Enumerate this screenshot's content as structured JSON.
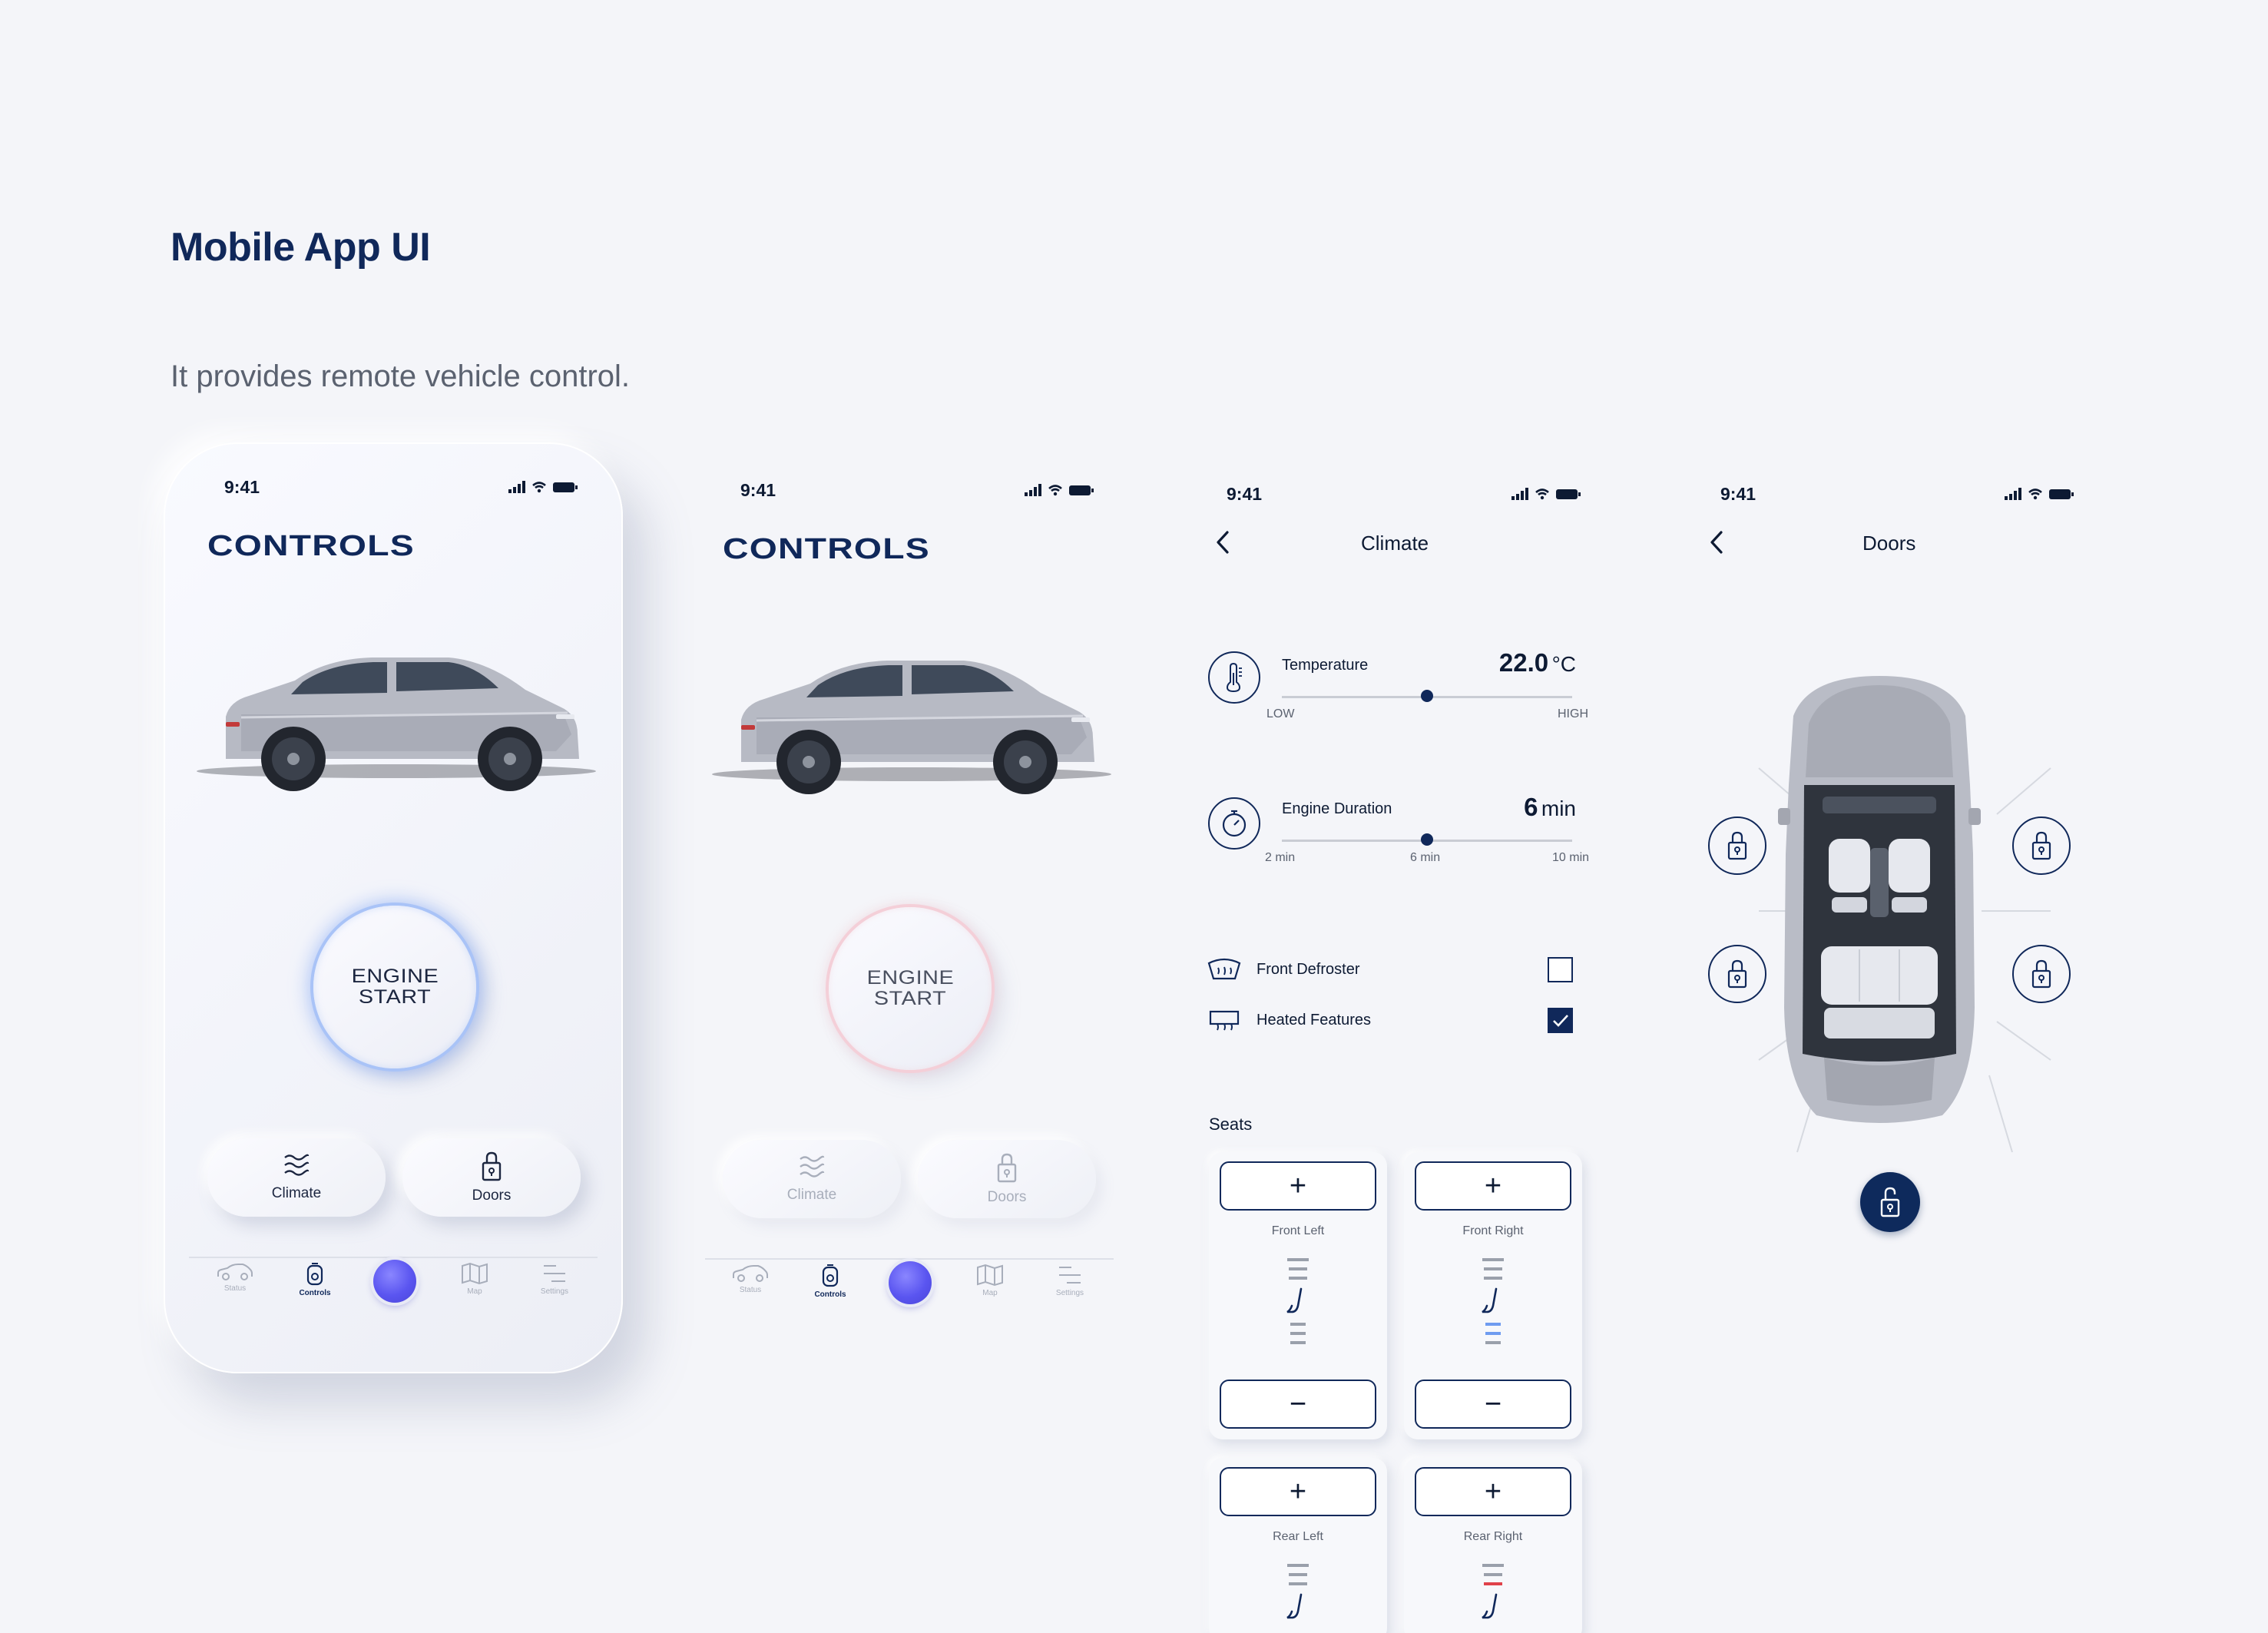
{
  "heading": {
    "title": "Mobile App UI",
    "subtitle": "It provides remote vehicle control."
  },
  "status_bar": {
    "time": "9:41"
  },
  "controls_screen": {
    "title": "CONTROLS",
    "engine_button": {
      "line1": "ENGINE",
      "line2": "START"
    },
    "shortcuts": [
      {
        "label": "Climate",
        "icon": "waves-icon"
      },
      {
        "label": "Doors",
        "icon": "lock-icon"
      }
    ],
    "tabs": [
      {
        "label": "Status",
        "icon": "car-icon"
      },
      {
        "label": "Controls",
        "icon": "key-fob-icon",
        "active": true
      },
      {
        "label": "",
        "icon": "orb-icon"
      },
      {
        "label": "Map",
        "icon": "map-icon"
      },
      {
        "label": "Settings",
        "icon": "settings-lines-icon"
      }
    ]
  },
  "climate_screen": {
    "title": "Climate",
    "temperature": {
      "label": "Temperature",
      "value": "22.0",
      "unit": "°C",
      "low_label": "LOW",
      "high_label": "HIGH",
      "level": 0.5
    },
    "engine_duration": {
      "label": "Engine Duration",
      "value": "6",
      "unit": "min",
      "ticks": [
        "2 min",
        "6 min",
        "10 min"
      ],
      "level": 0.5
    },
    "options": [
      {
        "label": "Front Defroster",
        "checked": false,
        "icon": "defroster-icon"
      },
      {
        "label": "Heated Features",
        "checked": true,
        "icon": "rear-defroster-icon"
      }
    ],
    "seats_title": "Seats",
    "seats": [
      {
        "name": "Front Left",
        "plus": "+",
        "minus": "−",
        "level": 0,
        "mode": "none"
      },
      {
        "name": "Front Right",
        "plus": "+",
        "minus": "−",
        "level": 2,
        "mode": "cool"
      },
      {
        "name": "Rear Left",
        "plus": "+",
        "level": 0,
        "mode": "none"
      },
      {
        "name": "Rear Right",
        "plus": "+",
        "level": 1,
        "mode": "heat"
      }
    ],
    "colors": {
      "cool": "#6f9cf0",
      "heat": "#e0424a",
      "idle": "#9aa0ab"
    }
  },
  "doors_screen": {
    "title": "Doors",
    "locks": [
      "front-left",
      "front-right",
      "rear-left",
      "rear-right"
    ],
    "main_lock_icon": "unlock-icon"
  },
  "colors": {
    "navy": "#10285a",
    "background": "#f4f5f9",
    "orb": "#5a55f0"
  }
}
